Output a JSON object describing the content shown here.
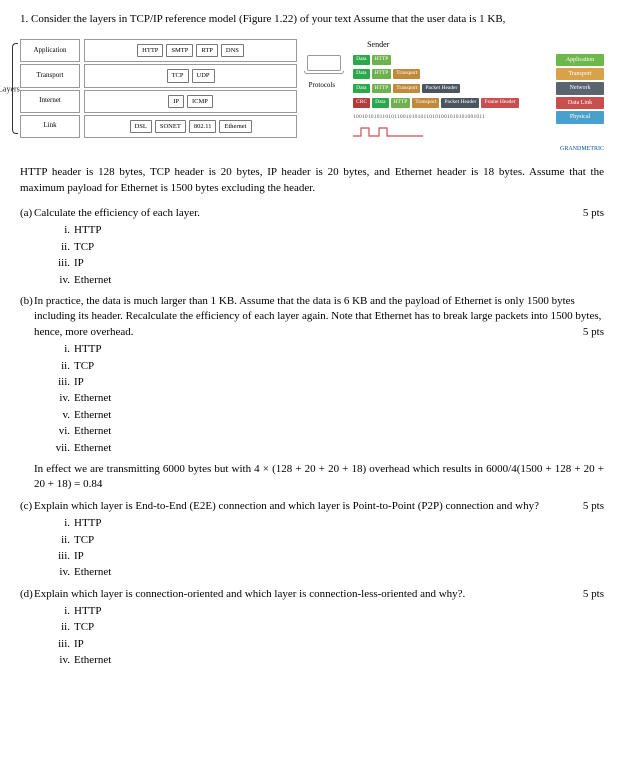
{
  "question_number": "1.",
  "question_text": "Consider the layers in TCP/IP reference model (Figure 1.22) of your text Assume that the user data is 1 KB,",
  "left_diagram": {
    "side_label": "Layers",
    "protocols_label": "Protocols",
    "rows": [
      {
        "label": "Application",
        "protos": [
          "HTTP",
          "SMTP",
          "RTP",
          "DNS"
        ]
      },
      {
        "label": "Transport",
        "protos": [
          "TCP",
          "UDP"
        ]
      },
      {
        "label": "Internet",
        "protos": [
          "IP",
          "ICMP"
        ]
      },
      {
        "label": "Link",
        "protos": [
          "DSL",
          "SONET",
          "802.11",
          "Ethernet"
        ]
      }
    ]
  },
  "right_diagram": {
    "sender_label": "Sender",
    "osi_layers": [
      "Application",
      "Transport",
      "Network",
      "Data Link",
      "Physical"
    ],
    "segments": {
      "data": "Data",
      "http": "HTTP",
      "transport": "Transport",
      "pkt": "Packet Header",
      "crc": "CRC",
      "frame": "Frame Header"
    },
    "bits": "100101010110101100101010110101001010101001011",
    "logo": "GRANDMETRIC"
  },
  "spec_text": "HTTP header is 128 bytes, TCP header is 20 bytes, IP header is 20 bytes, and Ethernet header is 18 bytes. Assume that the maximum payload for Ethernet is 1500 bytes excluding the header.",
  "parts": {
    "a": {
      "text": "Calculate the efficiency of each layer.",
      "pts": "5 pts",
      "items": [
        "HTTP",
        "TCP",
        "IP",
        "Ethernet"
      ]
    },
    "b": {
      "text": "In practice, the data is much larger than 1 KB. Assume that the data is 6 KB and the payload of Ethernet is only 1500 bytes including its header. Recalculate the efficiency of each layer again. Note that Ethernet has to break large packets into 1500 bytes, hence, more overhead.",
      "pts": "5 pts",
      "items": [
        "HTTP",
        "TCP",
        "IP",
        "Ethernet",
        "Ethernet",
        "Ethernet",
        "Ethernet"
      ],
      "calc": "In effect we are transmitting 6000 bytes but with 4 × (128 + 20 + 20 + 18) overhead which results in 6000/4(1500 + 128 + 20 + 20 + 18) = 0.84"
    },
    "c": {
      "text": "Explain which layer is End-to-End (E2E) connection and which layer is Point-to-Point (P2P) connection and why?",
      "pts": "5 pts",
      "items": [
        "HTTP",
        "TCP",
        "IP",
        "Ethernet"
      ]
    },
    "d": {
      "text": "Explain which layer is connection-oriented and which layer is connection-less-oriented and why?.",
      "pts": "5 pts",
      "items": [
        "HTTP",
        "TCP",
        "IP",
        "Ethernet"
      ]
    }
  },
  "romans": [
    "i.",
    "ii.",
    "iii.",
    "iv.",
    "v.",
    "vi.",
    "vii."
  ]
}
